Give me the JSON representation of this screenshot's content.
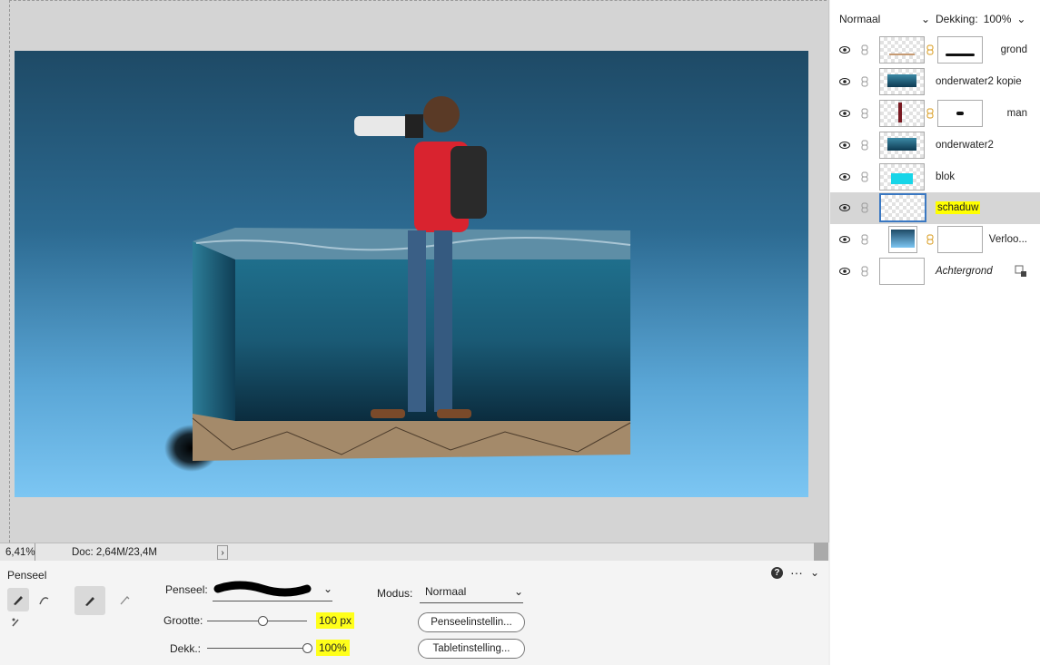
{
  "layers_panel": {
    "blend_mode": "Normaal",
    "opacity_label": "Dekking:",
    "opacity_value": "100%",
    "layers": [
      {
        "name": "grond",
        "thumb": "transparent-ground",
        "has_mask": true,
        "selected": false
      },
      {
        "name": "onderwater2 kopie",
        "thumb": "underwater",
        "has_mask": false,
        "selected": false
      },
      {
        "name": "man",
        "thumb": "man",
        "has_mask": true,
        "selected": false
      },
      {
        "name": "onderwater2",
        "thumb": "underwater",
        "has_mask": false,
        "selected": false
      },
      {
        "name": "blok",
        "thumb": "cyan-block",
        "has_mask": false,
        "selected": false
      },
      {
        "name": "schaduw",
        "thumb": "transparent",
        "has_mask": false,
        "selected": true
      },
      {
        "name": "Verloo...",
        "thumb": "gradient-adjust",
        "has_mask": true,
        "selected": false
      },
      {
        "name": "Achtergrond",
        "thumb": "white",
        "has_mask": false,
        "selected": false,
        "locked": true
      }
    ]
  },
  "status_bar": {
    "zoom": "6,41%",
    "doc_info": "Doc: 2,64M/23,4M",
    "arrow": "›"
  },
  "tool_options": {
    "title": "Penseel",
    "brush_label": "Penseel:",
    "mode_label": "Modus:",
    "mode_value": "Normaal",
    "size_label": "Grootte:",
    "size_value": "100 px",
    "opacity_label": "Dekk.:",
    "opacity_value": "100%",
    "brush_settings_button": "Penseelinstellin...",
    "tablet_settings_button": "Tabletinstelling...",
    "size_slider_fraction": 0.55,
    "opacity_slider_fraction": 1.0
  },
  "colors": {
    "highlight": "#ffff00",
    "selection_border": "#3a78c2",
    "sky_top": "#1e4a66",
    "sky_bottom": "#7cc6f3"
  }
}
